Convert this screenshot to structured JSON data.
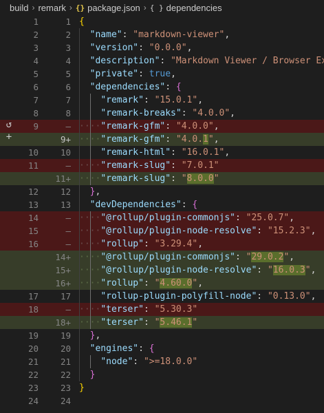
{
  "breadcrumb": {
    "items": [
      "build",
      "remark",
      "package.json",
      "dependencies"
    ],
    "json_icon": "{}",
    "obj_icon": "{ }"
  },
  "gutter": {
    "revert_icon": "↺",
    "stage_icon": "+"
  },
  "colors": {
    "deleted_line": "#4b1818",
    "inserted_line": "#373d29",
    "json_key": "#9cdcfe",
    "json_string": "#ce9178",
    "json_bool": "#569cd6"
  },
  "lines": [
    {
      "orig": "1",
      "mod": "1",
      "type": "ctx",
      "indent": 0,
      "tokens": [
        {
          "t": "{",
          "c": "br1"
        }
      ]
    },
    {
      "orig": "2",
      "mod": "2",
      "type": "ctx",
      "indent": 1,
      "tokens": [
        {
          "t": "\"name\"",
          "c": "k"
        },
        {
          "t": ": ",
          "c": "p"
        },
        {
          "t": "\"markdown-viewer\"",
          "c": "s"
        },
        {
          "t": ",",
          "c": "p"
        }
      ]
    },
    {
      "orig": "3",
      "mod": "3",
      "type": "ctx",
      "indent": 1,
      "tokens": [
        {
          "t": "\"version\"",
          "c": "k"
        },
        {
          "t": ": ",
          "c": "p"
        },
        {
          "t": "\"0.0.0\"",
          "c": "s"
        },
        {
          "t": ",",
          "c": "p"
        }
      ]
    },
    {
      "orig": "4",
      "mod": "4",
      "type": "ctx",
      "indent": 1,
      "tokens": [
        {
          "t": "\"description\"",
          "c": "k"
        },
        {
          "t": ": ",
          "c": "p"
        },
        {
          "t": "\"Markdown Viewer / Browser Ext",
          "c": "s"
        }
      ]
    },
    {
      "orig": "5",
      "mod": "5",
      "type": "ctx",
      "indent": 1,
      "tokens": [
        {
          "t": "\"private\"",
          "c": "k"
        },
        {
          "t": ": ",
          "c": "p"
        },
        {
          "t": "true",
          "c": "b"
        },
        {
          "t": ",",
          "c": "p"
        }
      ]
    },
    {
      "orig": "6",
      "mod": "6",
      "type": "ctx",
      "indent": 1,
      "tokens": [
        {
          "t": "\"dependencies\"",
          "c": "k"
        },
        {
          "t": ": ",
          "c": "p"
        },
        {
          "t": "{",
          "c": "br2"
        }
      ]
    },
    {
      "orig": "7",
      "mod": "7",
      "type": "ctx",
      "indent": 2,
      "tokens": [
        {
          "t": "\"remark\"",
          "c": "k"
        },
        {
          "t": ": ",
          "c": "p"
        },
        {
          "t": "\"15.0.1\"",
          "c": "s"
        },
        {
          "t": ",",
          "c": "p"
        }
      ]
    },
    {
      "orig": "8",
      "mod": "8",
      "type": "ctx",
      "indent": 2,
      "tokens": [
        {
          "t": "\"remark-breaks\"",
          "c": "k"
        },
        {
          "t": ": ",
          "c": "p"
        },
        {
          "t": "\"4.0.0\"",
          "c": "s"
        },
        {
          "t": ",",
          "c": "p"
        }
      ]
    },
    {
      "orig": "9",
      "mod": "—",
      "type": "del",
      "indent": 2,
      "tokens": [
        {
          "t": "\"remark-gfm\"",
          "c": "k"
        },
        {
          "t": ": ",
          "c": "p"
        },
        {
          "t": "\"4.0.0\"",
          "c": "s"
        },
        {
          "t": ",",
          "c": "p"
        }
      ]
    },
    {
      "orig": "",
      "mod": "9+",
      "type": "ins",
      "indent": 2,
      "cur": true,
      "tokens": [
        {
          "t": "\"remark-gfm\"",
          "c": "k"
        },
        {
          "t": ": ",
          "c": "p"
        },
        {
          "t": "\"4.0.",
          "c": "s"
        },
        {
          "t": "1",
          "c": "s",
          "hl": "ins"
        },
        {
          "t": "\"",
          "c": "s"
        },
        {
          "t": ",",
          "c": "p"
        }
      ]
    },
    {
      "orig": "10",
      "mod": "10",
      "type": "ctx",
      "indent": 2,
      "tokens": [
        {
          "t": "\"remark-html\"",
          "c": "k"
        },
        {
          "t": ": ",
          "c": "p"
        },
        {
          "t": "\"16.0.1\"",
          "c": "s"
        },
        {
          "t": ",",
          "c": "p"
        }
      ]
    },
    {
      "orig": "11",
      "mod": "—",
      "type": "del",
      "indent": 2,
      "tokens": [
        {
          "t": "\"remark-slug\"",
          "c": "k"
        },
        {
          "t": ": ",
          "c": "p"
        },
        {
          "t": "\"7.0.1\"",
          "c": "s"
        }
      ]
    },
    {
      "orig": "",
      "mod": "11+",
      "type": "ins",
      "indent": 2,
      "tokens": [
        {
          "t": "\"remark-slug\"",
          "c": "k"
        },
        {
          "t": ": ",
          "c": "p"
        },
        {
          "t": "\"",
          "c": "s"
        },
        {
          "t": "8.0.0",
          "c": "s",
          "hl": "ins"
        },
        {
          "t": "\"",
          "c": "s"
        }
      ]
    },
    {
      "orig": "12",
      "mod": "12",
      "type": "ctx",
      "indent": 1,
      "tokens": [
        {
          "t": "}",
          "c": "br2"
        },
        {
          "t": ",",
          "c": "p"
        }
      ]
    },
    {
      "orig": "13",
      "mod": "13",
      "type": "ctx",
      "indent": 1,
      "tokens": [
        {
          "t": "\"devDependencies\"",
          "c": "k"
        },
        {
          "t": ": ",
          "c": "p"
        },
        {
          "t": "{",
          "c": "br2"
        }
      ]
    },
    {
      "orig": "14",
      "mod": "—",
      "type": "del",
      "indent": 2,
      "tokens": [
        {
          "t": "\"@rollup/plugin-commonjs\"",
          "c": "k"
        },
        {
          "t": ": ",
          "c": "p"
        },
        {
          "t": "\"25.0.7\"",
          "c": "s"
        },
        {
          "t": ",",
          "c": "p"
        }
      ]
    },
    {
      "orig": "15",
      "mod": "—",
      "type": "del",
      "indent": 2,
      "tokens": [
        {
          "t": "\"@rollup/plugin-node-resolve\"",
          "c": "k"
        },
        {
          "t": ": ",
          "c": "p"
        },
        {
          "t": "\"15.2.3\"",
          "c": "s"
        },
        {
          "t": ",",
          "c": "p"
        }
      ]
    },
    {
      "orig": "16",
      "mod": "—",
      "type": "del",
      "indent": 2,
      "tokens": [
        {
          "t": "\"rollup\"",
          "c": "k"
        },
        {
          "t": ": ",
          "c": "p"
        },
        {
          "t": "\"3.29.4\"",
          "c": "s"
        },
        {
          "t": ",",
          "c": "p"
        }
      ]
    },
    {
      "orig": "",
      "mod": "14+",
      "type": "ins",
      "indent": 2,
      "tokens": [
        {
          "t": "\"@rollup/plugin-commonjs\"",
          "c": "k"
        },
        {
          "t": ": ",
          "c": "p"
        },
        {
          "t": "\"",
          "c": "s"
        },
        {
          "t": "29.0.2",
          "c": "s",
          "hl": "ins"
        },
        {
          "t": "\"",
          "c": "s"
        },
        {
          "t": ",",
          "c": "p"
        }
      ]
    },
    {
      "orig": "",
      "mod": "15+",
      "type": "ins",
      "indent": 2,
      "tokens": [
        {
          "t": "\"@rollup/plugin-node-resolve\"",
          "c": "k"
        },
        {
          "t": ": ",
          "c": "p"
        },
        {
          "t": "\"",
          "c": "s"
        },
        {
          "t": "16.0.3",
          "c": "s",
          "hl": "ins"
        },
        {
          "t": "\"",
          "c": "s"
        },
        {
          "t": ",",
          "c": "p"
        }
      ]
    },
    {
      "orig": "",
      "mod": "16+",
      "type": "ins",
      "indent": 2,
      "tokens": [
        {
          "t": "\"rollup\"",
          "c": "k"
        },
        {
          "t": ": ",
          "c": "p"
        },
        {
          "t": "\"",
          "c": "s"
        },
        {
          "t": "4.60.0",
          "c": "s",
          "hl": "ins"
        },
        {
          "t": "\"",
          "c": "s"
        },
        {
          "t": ",",
          "c": "p"
        }
      ]
    },
    {
      "orig": "17",
      "mod": "17",
      "type": "ctx",
      "indent": 2,
      "tokens": [
        {
          "t": "\"rollup-plugin-polyfill-node\"",
          "c": "k"
        },
        {
          "t": ": ",
          "c": "p"
        },
        {
          "t": "\"0.13.0\"",
          "c": "s"
        },
        {
          "t": ",",
          "c": "p"
        }
      ]
    },
    {
      "orig": "18",
      "mod": "—",
      "type": "del",
      "indent": 2,
      "tokens": [
        {
          "t": "\"terser\"",
          "c": "k"
        },
        {
          "t": ": ",
          "c": "p"
        },
        {
          "t": "\"5.30.3\"",
          "c": "s"
        }
      ]
    },
    {
      "orig": "",
      "mod": "18+",
      "type": "ins",
      "indent": 2,
      "tokens": [
        {
          "t": "\"terser\"",
          "c": "k"
        },
        {
          "t": ": ",
          "c": "p"
        },
        {
          "t": "\"",
          "c": "s"
        },
        {
          "t": "5.46.1",
          "c": "s",
          "hl": "ins"
        },
        {
          "t": "\"",
          "c": "s"
        }
      ]
    },
    {
      "orig": "19",
      "mod": "19",
      "type": "ctx",
      "indent": 1,
      "tokens": [
        {
          "t": "}",
          "c": "br2"
        },
        {
          "t": ",",
          "c": "p"
        }
      ]
    },
    {
      "orig": "20",
      "mod": "20",
      "type": "ctx",
      "indent": 1,
      "tokens": [
        {
          "t": "\"engines\"",
          "c": "k"
        },
        {
          "t": ": ",
          "c": "p"
        },
        {
          "t": "{",
          "c": "br2"
        }
      ]
    },
    {
      "orig": "21",
      "mod": "21",
      "type": "ctx",
      "indent": 2,
      "tokens": [
        {
          "t": "\"node\"",
          "c": "k"
        },
        {
          "t": ": ",
          "c": "p"
        },
        {
          "t": "\">=18.0.0\"",
          "c": "s"
        }
      ]
    },
    {
      "orig": "22",
      "mod": "22",
      "type": "ctx",
      "indent": 1,
      "tokens": [
        {
          "t": "}",
          "c": "br2"
        }
      ]
    },
    {
      "orig": "23",
      "mod": "23",
      "type": "ctx",
      "indent": 0,
      "tokens": [
        {
          "t": "}",
          "c": "br1"
        }
      ]
    },
    {
      "orig": "24",
      "mod": "24",
      "type": "ctx",
      "indent": 0,
      "tokens": []
    }
  ]
}
